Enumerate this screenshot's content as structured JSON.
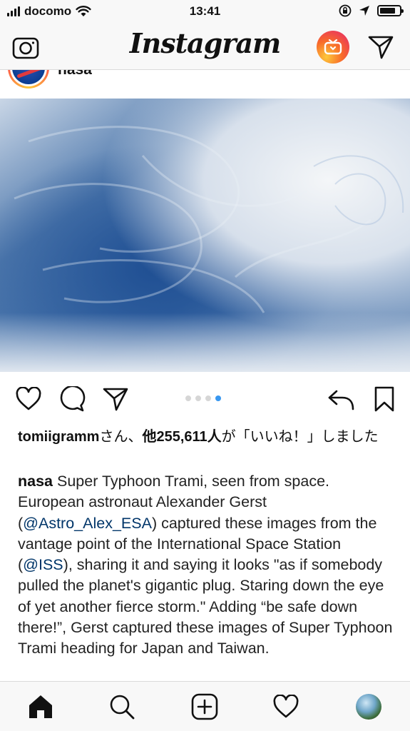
{
  "status_bar": {
    "carrier": "docomo",
    "time": "13:41"
  },
  "header": {
    "logo_text": "Instagram",
    "icons": [
      "camera-icon",
      "igtv-icon",
      "direct-message-icon"
    ]
  },
  "post": {
    "username": "nasa",
    "more_label": "···",
    "carousel": {
      "count": 4,
      "active_index": 3,
      "active_color": "#3897f0"
    },
    "likes": {
      "first_liker": "tomiigramm",
      "mid_text": "さん、",
      "count_text": "他255,611人",
      "suffix": "が「いいね！」しました"
    },
    "caption": {
      "author": "nasa",
      "t1": " Super Typhoon Trami, seen from space. European astronaut Alexander Gerst (",
      "m1": "@Astro_Alex_ESA",
      "t2": ") captured these images from the vantage point of the International Space Station (",
      "m2": "@ISS",
      "t3": "), sharing it and saying it looks \"as if somebody pulled the planet's gigantic plug. Staring down the eye of yet another fierce storm.\" Adding “be safe down there!”, Gerst captured these images of Super Typhoon Trami heading for Japan and Taiwan."
    }
  },
  "colors": {
    "bar_bg": "#f8f8f8",
    "border": "#dbdbdb",
    "mention": "#003569",
    "igtv_gradient": [
      "#fdc93a",
      "#f86b2a",
      "#e5236f"
    ]
  },
  "bottom_nav": [
    "home-icon",
    "search-icon",
    "add-post-icon",
    "activity-heart-icon",
    "profile-avatar"
  ]
}
